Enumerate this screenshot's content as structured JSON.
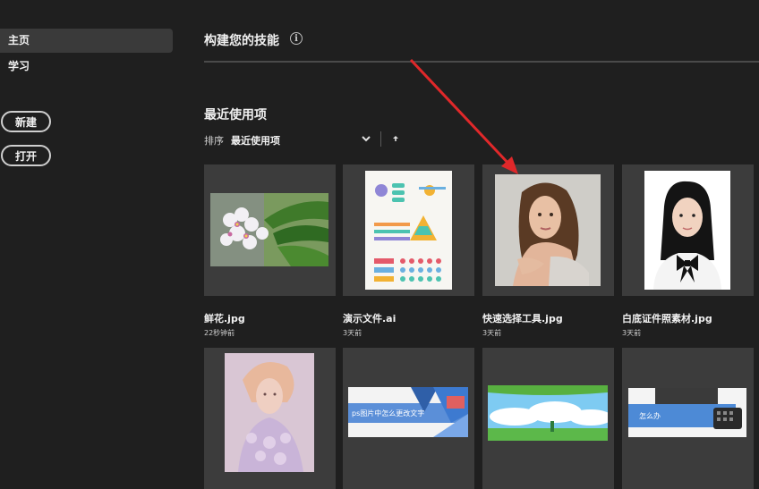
{
  "sidebar": {
    "home_label": "主页",
    "learn_label": "学习",
    "new_label": "新建",
    "open_label": "打开"
  },
  "header": {
    "skills_title": "构建您的技能",
    "info_icon": "info-icon"
  },
  "recent": {
    "title": "最近使用项",
    "sort_label": "排序",
    "sort_value": "最近使用项"
  },
  "files": [
    {
      "name": "鲜花.jpg",
      "time": "22秒钟前"
    },
    {
      "name": "演示文件.ai",
      "time": "3天前"
    },
    {
      "name": "快速选择工具.jpg",
      "time": "3天前"
    },
    {
      "name": "白底证件照素材.jpg",
      "time": "3天前"
    }
  ],
  "row2": [
    {
      "thumb_text": ""
    },
    {
      "thumb_text": "ps图片中怎么更改文字"
    },
    {
      "thumb_text": ""
    },
    {
      "thumb_text": "怎么办"
    }
  ],
  "colors": {
    "background": "#1f1f1f",
    "card": "#3c3c3c",
    "annotation_arrow": "#e0282a"
  }
}
